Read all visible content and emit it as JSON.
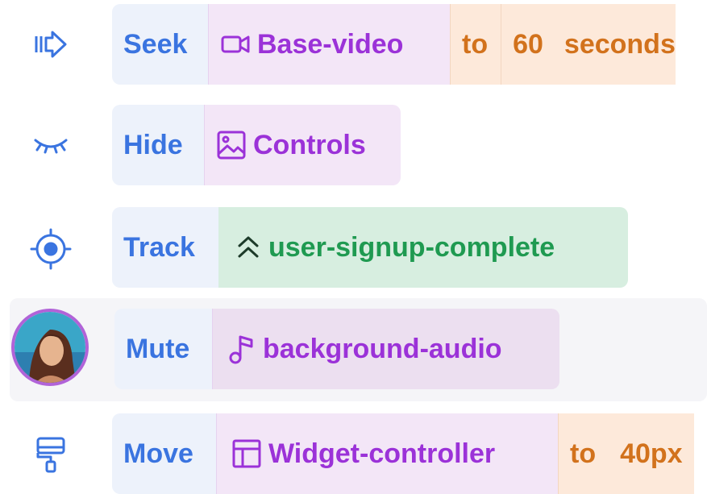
{
  "rows": [
    {
      "icon": "fast-forward-icon",
      "verb": "Seek",
      "target_icon": "video-icon",
      "target": "Base-video",
      "preposition": "to",
      "value": "60",
      "unit": "seconds"
    },
    {
      "icon": "eye-closed-icon",
      "verb": "Hide",
      "target_icon": "image-icon",
      "target": "Controls"
    },
    {
      "icon": "crosshair-icon",
      "verb": "Track",
      "target_icon": "chevrons-up-icon",
      "target": "user-signup-complete"
    },
    {
      "icon": "avatar",
      "verb": "Mute",
      "target_icon": "music-note-icon",
      "target": "background-audio"
    },
    {
      "icon": "paint-roller-icon",
      "verb": "Move",
      "target_icon": "layout-icon",
      "target": "Widget-controller",
      "preposition": "to",
      "value": "40px"
    }
  ],
  "colors": {
    "verb": "#3a74e0",
    "purple": "#9b32d8",
    "green": "#1f9a51",
    "orange": "#d2721c",
    "avatar_ring": "#b163d8"
  }
}
